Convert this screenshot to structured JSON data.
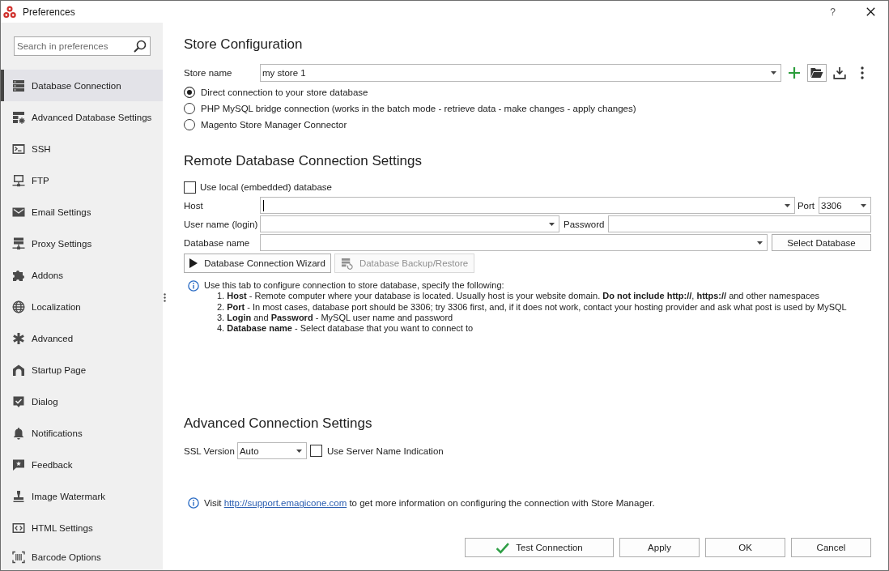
{
  "window": {
    "title": "Preferences",
    "help": "?"
  },
  "sidebar": {
    "search": {
      "placeholder": "Search in preferences"
    },
    "items": [
      {
        "label": "Database Connection",
        "selected": true
      },
      {
        "label": "Advanced Database Settings",
        "selected": false
      },
      {
        "label": "SSH",
        "selected": false
      },
      {
        "label": "FTP",
        "selected": false
      },
      {
        "label": "Email Settings",
        "selected": false
      },
      {
        "label": "Proxy Settings",
        "selected": false
      },
      {
        "label": "Addons",
        "selected": false
      },
      {
        "label": "Localization",
        "selected": false
      },
      {
        "label": "Advanced",
        "selected": false
      },
      {
        "label": "Startup Page",
        "selected": false
      },
      {
        "label": "Dialog",
        "selected": false
      },
      {
        "label": "Notifications",
        "selected": false
      },
      {
        "label": "Feedback",
        "selected": false
      },
      {
        "label": "Image Watermark",
        "selected": false
      },
      {
        "label": "HTML Settings",
        "selected": false
      },
      {
        "label": "Barcode Options",
        "selected": false
      }
    ]
  },
  "store_configuration": {
    "title": "Store Configuration",
    "store_name": {
      "label": "Store name",
      "value": "my store 1"
    },
    "connection_types": [
      {
        "label": "Direct connection to your store database",
        "selected": true
      },
      {
        "label": "PHP MySQL bridge connection (works in the batch mode - retrieve data - make changes - apply changes)",
        "selected": false
      },
      {
        "label": "Magento Store Manager Connector",
        "selected": false
      }
    ]
  },
  "remote_database": {
    "title": "Remote Database Connection Settings",
    "use_local": {
      "label": "Use local (embedded) database",
      "checked": false
    },
    "host": {
      "label": "Host",
      "focused": true
    },
    "port": {
      "label": "Port",
      "value": "3306"
    },
    "user_name": {
      "label": "User name (login)"
    },
    "password": {
      "label": "Password"
    },
    "database_name": {
      "label": "Database name"
    },
    "select_database": "Select Database",
    "actions": [
      {
        "label": "Database Connection Wizard",
        "kind": "wizard",
        "disabled": false
      },
      {
        "label": "Database Backup/Restore",
        "kind": "backup",
        "disabled": true
      }
    ],
    "help": {
      "intro": "Use this tab to configure connection to store database, specify the following:",
      "steps": [
        "1. **Host** - Remote computer where your database is located. Usually host is your website domain. **Do not include http://**, **https://** and other namespaces",
        "2. **Port** - In most cases, database port should be 3306; try 3306 first, and, if it does not work, contact your hosting provider and ask what post is used by MySQL",
        "3. **Login** and **Password** - MySQL user name and password",
        "4. **Database name** - Select database that you want to connect to"
      ]
    }
  },
  "advanced_connection": {
    "title": "Advanced Connection Settings",
    "ssl_version": {
      "label": "SSL Version",
      "value": "Auto"
    },
    "sni": {
      "label": "Use Server Name Indication",
      "checked": false
    }
  },
  "support_note": {
    "before": "Visit",
    "link": "http://support.emagicone.com",
    "after": "to get more information on configuring the connection with Store Manager."
  },
  "footer_buttons": [
    {
      "label": "Test Connection",
      "kind": "test"
    },
    {
      "label": "Apply",
      "kind": "plain"
    },
    {
      "label": "OK",
      "kind": "plain"
    },
    {
      "label": "Cancel",
      "kind": "plain"
    }
  ]
}
